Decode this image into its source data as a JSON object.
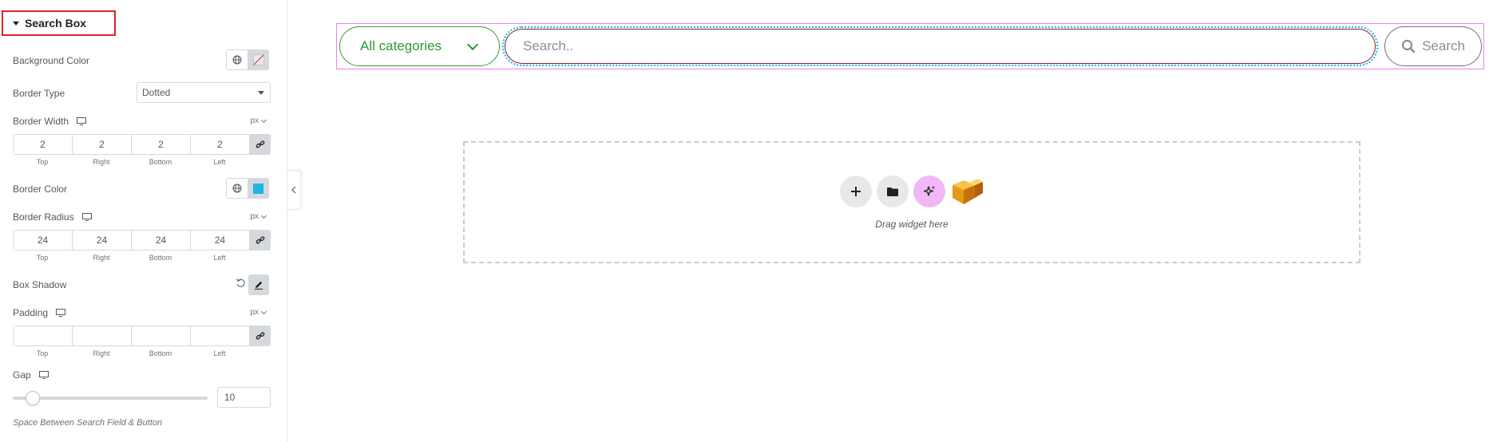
{
  "panel": {
    "section_title": "Search Box",
    "background_color": {
      "label": "Background Color"
    },
    "border_type": {
      "label": "Border Type",
      "value": "Dotted"
    },
    "border_width": {
      "label": "Border Width",
      "unit": "px",
      "top": "2",
      "right": "2",
      "bottom": "2",
      "left": "2"
    },
    "border_color": {
      "label": "Border Color",
      "swatch": "#1fb5e8"
    },
    "border_radius": {
      "label": "Border Radius",
      "unit": "px",
      "top": "24",
      "right": "24",
      "bottom": "24",
      "left": "24"
    },
    "box_shadow": {
      "label": "Box Shadow"
    },
    "padding": {
      "label": "Padding",
      "unit": "px",
      "top": "",
      "right": "",
      "bottom": "",
      "left": ""
    },
    "dim_labels": {
      "top": "Top",
      "right": "Right",
      "bottom": "Bottom",
      "left": "Left"
    },
    "gap": {
      "label": "Gap",
      "value": "10",
      "hint": "Space Between Search Field & Button"
    }
  },
  "canvas": {
    "category_label": "All categories",
    "search_placeholder": "Search..",
    "search_button": "Search",
    "drop_text": "Drag widget here"
  }
}
